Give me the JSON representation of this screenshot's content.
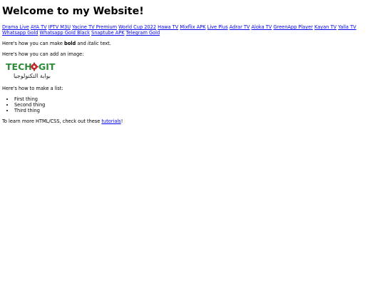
{
  "heading": "Welcome to my Website!",
  "links": [
    "Drama Live",
    "AYA TV",
    "IPTV M3U",
    "Yacine TV Premium",
    "World Cup 2022",
    "Hawa TV",
    "Mixflix APK",
    "Live Plus",
    "Adrar TV",
    "Aloka TV",
    "GreenApp Player",
    "Kayan TV",
    "Yalla TV",
    "Whatsapp Gold",
    "Whatsapp Gold Black",
    "Snaptube APK",
    "Telegram Gold"
  ],
  "formatting": {
    "before": "Here's how you can make ",
    "bold": "bold",
    "middle": " and ",
    "italic": "italic",
    "after": " text."
  },
  "image_intro": "Here's how you can add an image:",
  "logo": {
    "text_left": "TECH",
    "text_right": "GIT",
    "subtitle": "بوابة التكنولوجيا",
    "primary_color": "#2e8b3a",
    "accent_color": "#c0272d"
  },
  "list_intro": "Here's how to make a list:",
  "list_items": [
    "First thing",
    "Second thing",
    "Third thing"
  ],
  "learn_more": {
    "before": "To learn more HTML/CSS, check out these ",
    "link": "tutorials",
    "after": "!"
  }
}
